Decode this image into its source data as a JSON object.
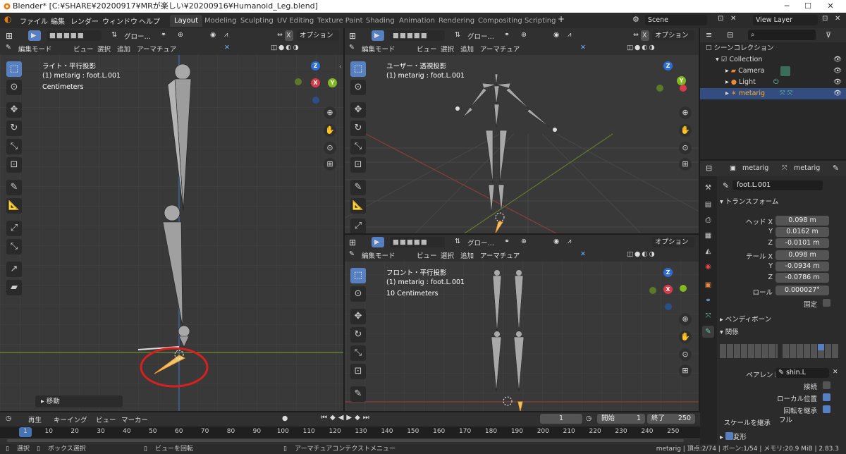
{
  "window": {
    "title": "Blender* [C:¥SHARE¥20200917¥MRが楽しい¥20200916¥Humanoid_Leg.blend]",
    "minimize": "─",
    "maximize": "☐",
    "close": "✕"
  },
  "menu": {
    "items": [
      "ファイル",
      "編集",
      "レンダー",
      "ウィンドウ",
      "ヘルプ"
    ],
    "workspaces": [
      "Layout",
      "Modeling",
      "Sculpting",
      "UV Editing",
      "Texture Paint",
      "Shading",
      "Animation",
      "Rendering",
      "Compositing",
      "Scripting"
    ],
    "add_workspace": "+",
    "scene": "Scene",
    "view_layer": "View Layer"
  },
  "viewport_header": {
    "transform": "グロー…",
    "options": "オプション",
    "mode": "編集モード",
    "view": "ビュー",
    "select": "選択",
    "add": "追加",
    "armature": "アーマチュア",
    "x_label": "X"
  },
  "viewports": {
    "left": {
      "title": "ライト・平行投影",
      "object": "(1) metarig : foot.L.001",
      "units": "Centimeters",
      "last_op": "移動"
    },
    "top_right": {
      "title": "ユーザー・透視投影",
      "object": "(1) metarig : foot.L.001"
    },
    "bottom_right": {
      "title": "フロント・平行投影",
      "object": "(1) metarig : foot.L.001",
      "units": "10 Centimeters"
    }
  },
  "gizmo": {
    "x": "X",
    "y": "Y",
    "z": "Z"
  },
  "outliner": {
    "root": "シーンコレクション",
    "collection": "Collection",
    "items": [
      "Camera",
      "Light",
      "metarig"
    ]
  },
  "properties": {
    "object": "metarig",
    "armature": "metarig",
    "bone": "foot.L.001",
    "transform": "トランスフォーム",
    "head_label": "ヘッド X",
    "tail_label": "テール X",
    "y": "Y",
    "z": "Z",
    "roll_label": "ロール",
    "head": [
      "0.098 m",
      "0.0162 m",
      "-0.0101 m"
    ],
    "tail": [
      "0.098 m",
      "-0.0934 m",
      "-0.0786 m"
    ],
    "roll": "0.000027°",
    "lock": "固定",
    "bendy": "ベンディボーン",
    "relations": "関係",
    "parent_label": "ペアレント",
    "parent": "shin.L",
    "connected": "接続",
    "local_location": "ローカル位置",
    "inherit_rotation": "回転を継承",
    "inherit_scale_label": "スケールを継承",
    "inherit_scale": "フル",
    "deform": "変形"
  },
  "timeline": {
    "playback": "再生",
    "keying": "キーイング",
    "view": "ビュー",
    "marker": "マーカー",
    "current_frame": "1",
    "start_label": "開始",
    "start": "1",
    "end_label": "終了",
    "end": "250",
    "ruler": [
      "1",
      "10",
      "20",
      "30",
      "40",
      "50",
      "60",
      "70",
      "80",
      "90",
      "100",
      "110",
      "120",
      "130",
      "140",
      "150",
      "160",
      "170",
      "180",
      "190",
      "200",
      "210",
      "220",
      "230",
      "240",
      "250"
    ]
  },
  "status": {
    "select": "選択",
    "box_select": "ボックス選択",
    "rotate_view": "ビューを回転",
    "context_menu": "アーマチュアコンテクストメニュー",
    "info": "metarig | 頂点:2/74 | ボーン:1/54 | メモリ:20.9 MiB | 2.83.3"
  },
  "colors": {
    "accent": "#5680c2",
    "selected": "#4772b3",
    "highlight_ring": "#d82020"
  }
}
